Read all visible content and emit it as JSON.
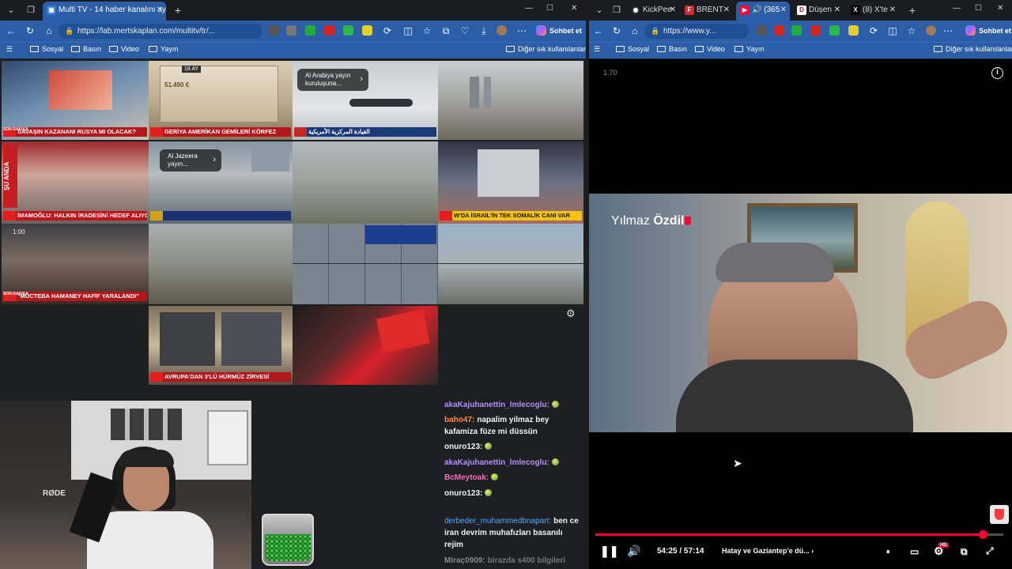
{
  "left_window": {
    "tabs": [
      {
        "title": "Multi TV - 14 haber kanalını aynı a",
        "active": true
      }
    ],
    "new_tab": "+",
    "url": "https://lab.mertskaplan.com/multitv/tr/...",
    "sohbet": "Sohbet et",
    "bookmarks": [
      "Sosyal",
      "Basın",
      "Video",
      "Yayın"
    ],
    "other_bookmarks": "Diğer sık kullanılanlar",
    "tiles": [
      {
        "caption": "SAVAŞIN KAZANANI RUSYA MI OLACAK?",
        "badge": "SON DAKİKA"
      },
      {
        "caption": "GERİYA AMERİKAN GEMİLERİ KÖRFEZ",
        "badge": "",
        "date_badge": "18 AY",
        "price": "51.490 €"
      },
      {
        "caption": "القيادة المركزية الأمريكية",
        "overlay": "Al Arabiya yayın kuruluşuna..."
      },
      {
        "caption": ""
      },
      {
        "caption": "İMAMOĞLU: HALKIN İRADESİNİ HEDEF ALIYORLAR",
        "side": "ŞU ANDA"
      },
      {
        "caption": "",
        "overlay": "Al Jazeera yayın..."
      },
      {
        "caption": ""
      },
      {
        "caption": "W'DA İSRAİL'İN TEK SOMALİK CANI VAR"
      },
      {
        "caption": "\"MÜCTEBA HAMANEY HAFİF YARALANDI\"",
        "badge": "SON DAKİKA",
        "time": "1:00"
      },
      {
        "caption": ""
      },
      {
        "caption": ""
      },
      {
        "caption": ""
      },
      {
        "caption": "AVRUPA'DAN 3'LÜ HÜRMÜZ ZİRVESİ"
      },
      {
        "caption": ""
      }
    ],
    "chat": [
      {
        "user": "akaKajuhanettin_lmlecoglu:",
        "user_color": "#b58dff",
        "text": ""
      },
      {
        "user": "baho47:",
        "user_color": "#ff8a3d",
        "text": "napalim yilmaz bey kafamiza füze mi düssün"
      },
      {
        "user": "onuro123:",
        "user_color": "#f1f1f1",
        "text": ""
      },
      {
        "user": "akaKajuhanettin_lmlecoglu:",
        "user_color": "#b58dff",
        "text": ""
      },
      {
        "user": "BcMeytoak:",
        "user_color": "#ff6bb5",
        "text": ""
      },
      {
        "user": "onuro123:",
        "user_color": "#f1f1f1",
        "text": ""
      },
      {
        "user": "derbeder_muhammedbnapart:",
        "user_color": "#4aa8ff",
        "text": "ben ce iran devrim muhafızları basanılı rejim"
      },
      {
        "user": "Miraç0909:",
        "user_color": "#888888",
        "text": "birazda s400 bilgileri"
      }
    ]
  },
  "right_window": {
    "tabs": [
      {
        "title": "KickPee",
        "active": false
      },
      {
        "title": "BRENT",
        "active": false
      },
      {
        "title": "(365",
        "active": true
      },
      {
        "title": "Düşen",
        "active": false
      },
      {
        "title": "(8) X'te",
        "active": false
      }
    ],
    "url": "https://www.y...",
    "sohbet": "Sohbet et",
    "bookmarks": [
      "Sosyal",
      "Basın",
      "Video",
      "Yayın"
    ],
    "other_bookmarks": "Diğer sık kullanılanlar",
    "video": {
      "speed": "1.70",
      "overlay_name_first": "Yılmaz",
      "overlay_name_last": "Özdil",
      "time_current": "54:25",
      "time_total": "57:14",
      "time_sep": " / ",
      "chapter": "Hatay ve Gaziantep'e dü...",
      "progress": 0.95,
      "hd_badge": "HD"
    }
  },
  "colors": {
    "browser_blue": "#2b5ea6",
    "yt_red": "#ff0033",
    "news_red": "#b3161b"
  }
}
